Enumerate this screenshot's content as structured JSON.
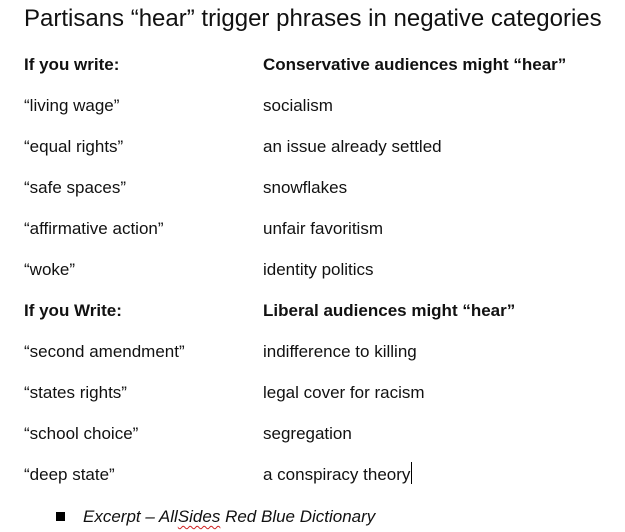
{
  "title": "Partisans “hear” trigger phrases in negative categories",
  "section1": {
    "header_left": "If you write:",
    "header_right": "Conservative audiences might “hear”",
    "rows": [
      {
        "phrase": "“living wage”",
        "heard": "socialism"
      },
      {
        "phrase": "“equal rights”",
        "heard": "an issue already settled"
      },
      {
        "phrase": "“safe spaces”",
        "heard": "snowflakes"
      },
      {
        "phrase": "“affirmative action”",
        "heard": "unfair favoritism"
      },
      {
        "phrase": "“woke”",
        "heard": "identity politics"
      }
    ]
  },
  "section2": {
    "header_left": "If you Write:",
    "header_right": "Liberal audiences might “hear”",
    "rows": [
      {
        "phrase": "“second amendment”",
        "heard": "indifference to killing"
      },
      {
        "phrase": "“states rights”",
        "heard": "legal cover for racism"
      },
      {
        "phrase": "“school choice”",
        "heard": "segregation"
      },
      {
        "phrase": "“deep state”",
        "heard": "a conspiracy theory"
      }
    ]
  },
  "footer": {
    "prefix": "Excerpt – ",
    "source_a": "All",
    "source_b": "Sides",
    "source_c": " Red Blue Dictionary"
  }
}
